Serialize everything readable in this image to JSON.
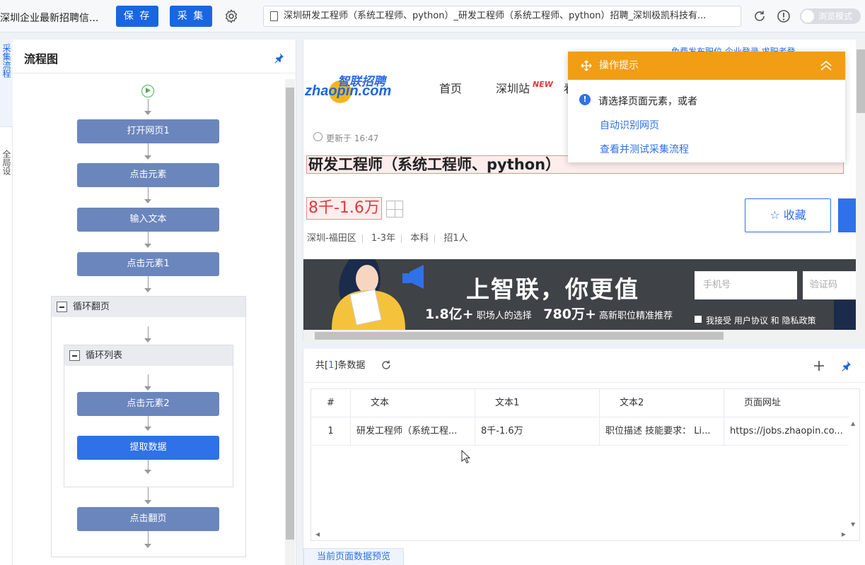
{
  "topbar": {
    "task_title": "深圳企业最新招聘信...",
    "save_label": "保 存",
    "collect_label": "采 集",
    "url": "深圳研发工程师（系统工程师、python）_研发工程师（系统工程师、python）招聘_深圳极凯科技有...",
    "browse_mode": "浏览模式"
  },
  "sidetabs": [
    "采集流程",
    "全局设"
  ],
  "flow": {
    "title": "流程图",
    "nodes": {
      "open_page": "打开网页1",
      "click_element": "点击元素",
      "input_text": "输入文本",
      "click_element1": "点击元素1",
      "loop_page": "循环翻页",
      "loop_list": "循环列表",
      "click_element2": "点击元素2",
      "extract_data": "提取数据",
      "click_next_page": "点击翻页"
    }
  },
  "browser": {
    "top_links": "免费发布职位  企业登录      求职者登",
    "logo_cn": "智联招聘",
    "logo_en": "zhaopin.com",
    "nav": [
      "首页",
      "深圳站",
      "看"
    ],
    "nav_new": "NEW",
    "updated": "更新于 16:47",
    "job_title": "研发工程师（系统工程师、python）",
    "salary": "8千-1.6万",
    "meta": [
      "深圳-福田区",
      "1-3年",
      "本科",
      "招1人"
    ],
    "favorite": "收藏",
    "banner": {
      "slogan": "上智联，你更值",
      "stat1_num": "1.8亿+",
      "stat1_text": "职场人的选择",
      "stat2_num": "780万+",
      "stat2_text": "高新职位精准推荐",
      "phone_placeholder": "手机号",
      "code_placeholder": "验证码",
      "agree": "我接受 用户协议 和 隐私政策"
    }
  },
  "tip": {
    "title": "操作提示",
    "message": "请选择页面元素，或者",
    "link1": "自动识别网页",
    "link2": "查看并测试采集流程"
  },
  "data": {
    "count_prefix": "共[",
    "count": "1",
    "count_suffix": "]条数据",
    "columns": [
      "#",
      "文本",
      "文本1",
      "文本2",
      "页面网址"
    ],
    "rows": [
      [
        "1",
        "研发工程师（系统工程...",
        "8千-1.6万",
        "职位描述 技能要求： Li...",
        "https://jobs.zhaopin.co..."
      ]
    ],
    "bottom_tab": "当前页面数据预览"
  },
  "colors": {
    "primary": "#1a66e0",
    "node": "#6b86bd",
    "node_active": "#2f71e8",
    "tip_header": "#f19e14",
    "salary_red": "#e2393b"
  }
}
